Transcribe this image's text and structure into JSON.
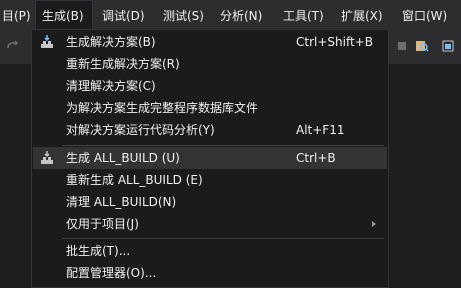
{
  "menubar": {
    "items": [
      {
        "label": "目(P)"
      },
      {
        "label": "生成(B)"
      },
      {
        "label": "调试(D)"
      },
      {
        "label": "测试(S)"
      },
      {
        "label": "分析(N)"
      },
      {
        "label": "工具(T)"
      },
      {
        "label": "扩展(X)"
      },
      {
        "label": "窗口(W)"
      }
    ]
  },
  "build_menu": {
    "items": [
      {
        "label": "生成解决方案(B)",
        "shortcut": "Ctrl+Shift+B",
        "icon": "build-solution-icon"
      },
      {
        "label": "重新生成解决方案(R)",
        "shortcut": ""
      },
      {
        "label": "清理解决方案(C)",
        "shortcut": ""
      },
      {
        "label": "为解决方案生成完整程序数据库文件",
        "shortcut": ""
      },
      {
        "label": "对解决方案运行代码分析(Y)",
        "shortcut": "Alt+F11"
      },
      {
        "label": "生成 ALL_BUILD (U)",
        "shortcut": "Ctrl+B",
        "icon": "build-project-icon",
        "highlighted": true
      },
      {
        "label": "重新生成 ALL_BUILD (E)",
        "shortcut": ""
      },
      {
        "label": "清理 ALL_BUILD(N)",
        "shortcut": ""
      },
      {
        "label": "仅用于项目(J)",
        "shortcut": "",
        "submenu": true
      },
      {
        "label": "批生成(T)...",
        "shortcut": ""
      },
      {
        "label": "配置管理器(O)...",
        "shortcut": ""
      }
    ]
  },
  "colors": {
    "background": "#2d2d30",
    "menu_bg": "#1b1b1c",
    "highlight": "#333334",
    "text": "#f1f1f1"
  }
}
